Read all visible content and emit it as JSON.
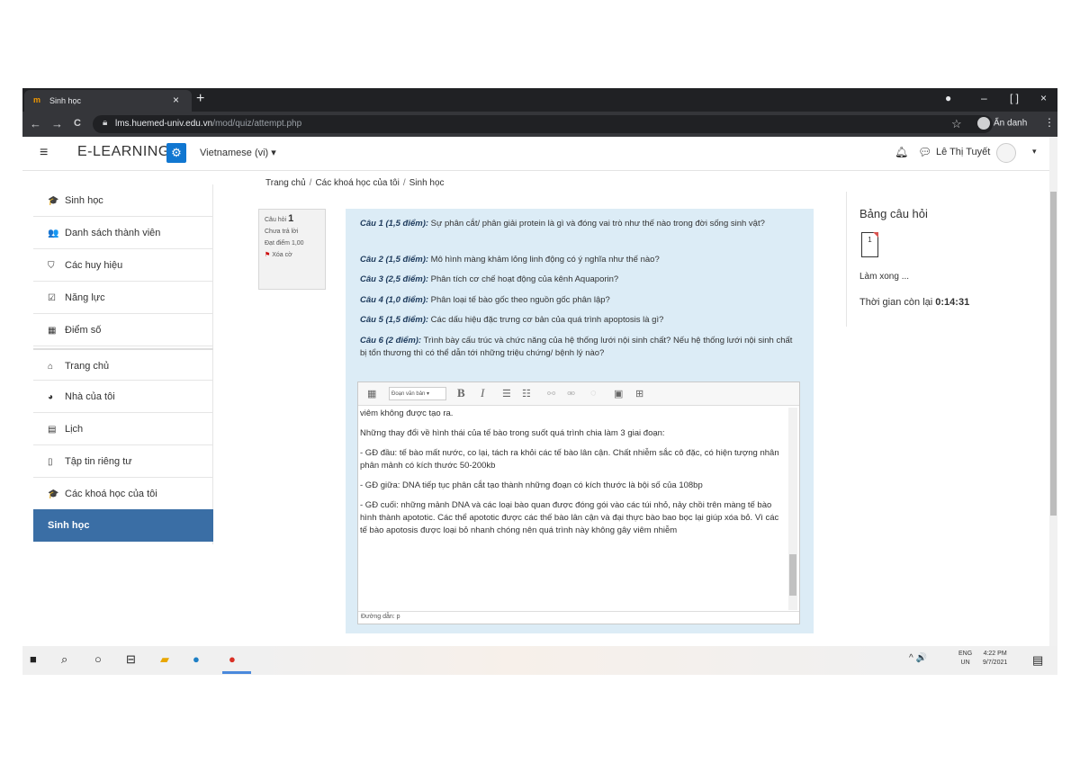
{
  "browser": {
    "tab_title": "Sinh học",
    "tab_favicon": "m",
    "tab_close": "×",
    "new_tab": "+",
    "url_host": "lms.huemed-univ.edu.vn",
    "url_path": "/mod/quiz/attempt.php",
    "incognito_label": "Ẩn danh",
    "back": "←",
    "forward": "→",
    "reload": "C",
    "win_min": "–",
    "win_max": "[ ]",
    "win_close": "×"
  },
  "navbar": {
    "brand": "E-LEARNING",
    "language": "Vietnamese (vi) ▾",
    "user_name": "Lê Thị Tuyết",
    "caret": "▾"
  },
  "sidebar": {
    "items": [
      {
        "label": "Sinh học",
        "icon": "graduation-cap-icon",
        "glyph": "🎓"
      },
      {
        "label": "Danh sách thành viên",
        "icon": "users-icon",
        "glyph": "👥"
      },
      {
        "label": "Các huy hiệu",
        "icon": "shield-icon",
        "glyph": "⛉"
      },
      {
        "label": "Năng lực",
        "icon": "checkbox-icon",
        "glyph": "☑"
      },
      {
        "label": "Điểm số",
        "icon": "table-icon",
        "glyph": "▦"
      },
      {
        "label": "Trang chủ",
        "icon": "home-icon",
        "glyph": "⌂"
      },
      {
        "label": "Nhà của tôi",
        "icon": "dashboard-icon",
        "glyph": "◕"
      },
      {
        "label": "Lịch",
        "icon": "calendar-icon",
        "glyph": "▤"
      },
      {
        "label": "Tập tin riêng tư",
        "icon": "file-icon",
        "glyph": "▯"
      },
      {
        "label": "Các khoá học của tôi",
        "icon": "graduation-cap-icon",
        "glyph": "🎓"
      }
    ],
    "active": "Sinh học"
  },
  "breadcrumb": [
    "Trang chủ",
    "Các khoá học của tôi",
    "Sinh học"
  ],
  "question_info": {
    "label": "Câu hỏi",
    "number": "1",
    "status": "Chưa trả lời",
    "mark": "Đạt điểm 1,00",
    "flag": "Xóa cờ"
  },
  "questions": [
    {
      "head": "Câu 1 (1,5 điểm):",
      "text": " Sự phân cắt/ phân giải protein là gì và đóng vai trò như thế nào trong đời sống sinh vật?"
    },
    {
      "head": "Câu 2 (1,5 điểm):",
      "text": " Mô hình màng khảm lỏng linh động có ý nghĩa như thế nào?"
    },
    {
      "head": "Câu 3 (2,5 điểm):",
      "text": " Phân tích cơ chế hoạt động của kênh Aquaporin?"
    },
    {
      "head": "Câu 4 (1,0 điểm):",
      "text": " Phân loại tế bào gốc theo nguồn gốc phân lập?"
    },
    {
      "head": "Câu 5 (1,5 điểm):",
      "text": " Các dấu hiệu đặc trưng cơ bản của quá trình apoptosis là gì?"
    },
    {
      "head": "Câu 6 (2 điểm):",
      "text": " Trình bày cấu trúc và chức năng của hệ thống lưới nội sinh chất? Nếu hệ thống lưới nội sinh chất bị tổn thương thì có thể dẫn tới những triệu chứng/ bệnh lý nào?"
    }
  ],
  "editor": {
    "paragraph": "Đoạn văn bản ▾",
    "bold": "B",
    "italic": "I",
    "lines": [
      "viêm không được tạo ra.",
      "Những thay đổi về hình thái của tế bào trong suốt quá trình chia làm 3 giai đoạn:",
      "- GĐ đầu: tế bào mất nước, co lại, tách ra khỏi các tế bào lân cận. Chất nhiễm sắc cô đặc, có hiện tượng nhân phân mảnh có kích thước 50-200kb",
      "- GĐ giữa: DNA tiếp tục phân cắt tạo thành những đoạn có kích thước là bội số của 108bp",
      "- GĐ cuối: những mảnh DNA và các loại bào quan được đóng gói vào các túi nhỏ, nảy chồi trên màng tế bào hình thành apototic. Các thể apototic được các thế bào lân cận và đại thực bào bao bọc lại giúp xóa bỏ. Vì các tế bào apotosis được loại bỏ nhanh chóng nên quá trình này không gây viêm nhiễm"
    ],
    "path": "Đường dẫn: p"
  },
  "quiz_nav": {
    "title": "Bảng câu hỏi",
    "button": "1",
    "finish": "Làm xong ...",
    "time_label": "Thời gian còn lại ",
    "time_value": "0:14:31"
  },
  "taskbar": {
    "lang1": "ENG",
    "lang2": "UN",
    "time": "4:22 PM",
    "date": "9/7/2021",
    "tray": "^ 🔊"
  }
}
